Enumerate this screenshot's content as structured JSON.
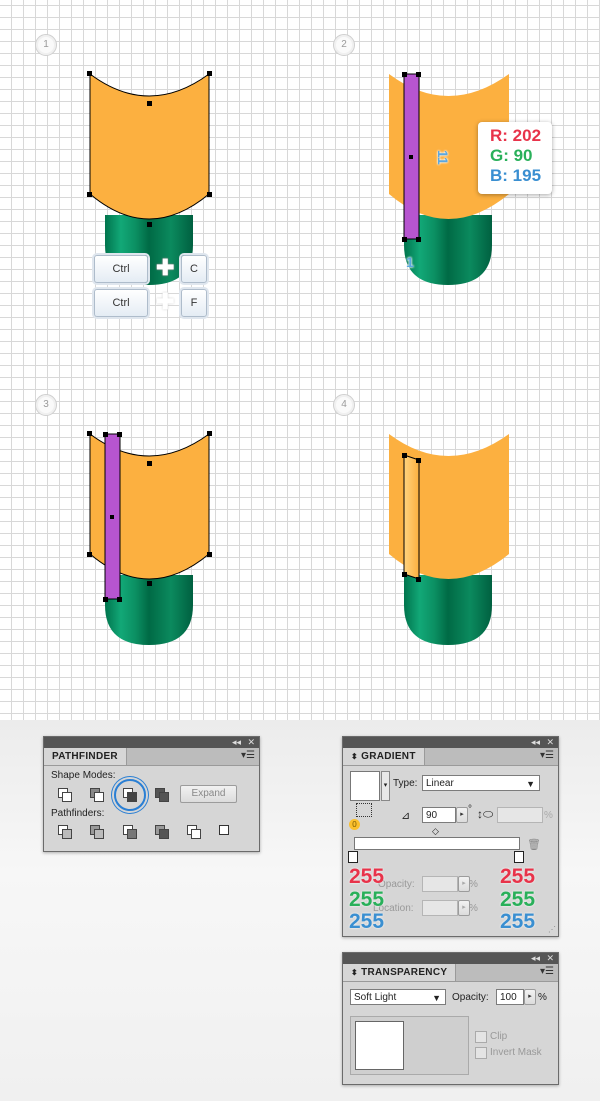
{
  "steps": [
    "1",
    "2",
    "3",
    "4"
  ],
  "keys": {
    "copy_modifier": "Ctrl",
    "copy_key": "C",
    "paste_modifier": "Ctrl",
    "paste_key": "F"
  },
  "color_info": {
    "r": "R: 202",
    "g": "G: 90",
    "b": "B: 195"
  },
  "dimensions": {
    "height": "11",
    "width": "1"
  },
  "colors": {
    "orange": "#fcb040",
    "green": "#00855a",
    "purple": "#b755d0",
    "red": "#e8334a",
    "green_text": "#29b05a",
    "blue_text": "#3a8fd1"
  },
  "pathfinder": {
    "title": "PATHFINDER",
    "shape_modes_label": "Shape Modes:",
    "pathfinders_label": "Pathfinders:",
    "expand_label": "Expand"
  },
  "gradient": {
    "title": "GRADIENT",
    "type_label": "Type:",
    "type_value": "Linear",
    "angle_value": "90",
    "degree_symbol": "°",
    "percent_symbol": "%",
    "opacity_label": "Opacity:",
    "location_label": "Location:",
    "left_stop": {
      "r": "255",
      "g": "255",
      "b": "255"
    },
    "right_stop": {
      "r": "255",
      "g": "255",
      "b": "255"
    }
  },
  "transparency": {
    "title": "TRANSPARENCY",
    "blend_mode": "Soft Light",
    "opacity_label": "Opacity:",
    "opacity_value": "100",
    "percent_symbol": "%",
    "clip_label": "Clip",
    "invert_mask_label": "Invert Mask"
  }
}
